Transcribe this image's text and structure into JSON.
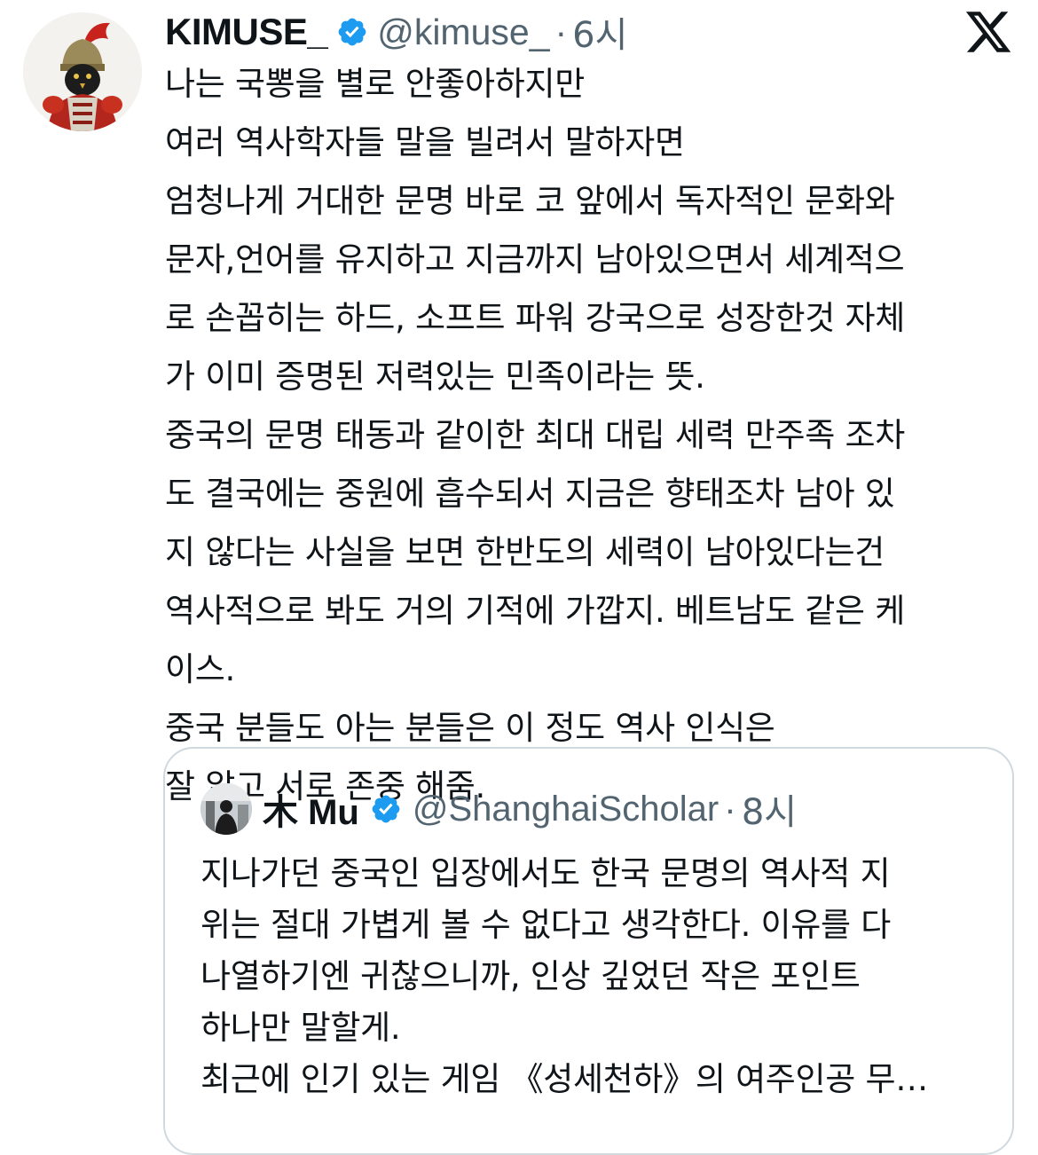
{
  "tweet": {
    "author": {
      "display_name": "KIMUSE_",
      "handle": "@kimuse_",
      "separator": "·",
      "time": "6시",
      "avatar_icon": "warrior-avatar-icon"
    },
    "verified_color": "#1d9bf0",
    "text_lines": [
      "나는 국뽕을 별로 안좋아하지만",
      "여러 역사학자들 말을 빌려서 말하자면",
      "엄청나게 거대한 문명 바로 코 앞에서 독자적인 문화와",
      "문자,언어를 유지하고 지금까지 남아있으면서 세계적으",
      "로 손꼽히는 하드, 소프트 파워 강국으로 성장한것 자체",
      "가 이미 증명된 저력있는 민족이라는 뜻.",
      "중국의 문명 태동과 같이한 최대 대립 세력 만주족 조차",
      "도 결국에는 중원에 흡수되서 지금은 향태조차 남아 있",
      "지 않다는 사실을 보면 한반도의 세력이 남아있다는건",
      "역사적으로 봐도 거의 기적에 가깝지. 베트남도 같은 케",
      "이스.",
      "중국 분들도 아는 분들은 이 정도 역사 인식은",
      "잘 알고 서로 존중 해줌."
    ]
  },
  "quoted_tweet": {
    "author": {
      "display_name": "木 Mu",
      "handle": "@ShanghaiScholar",
      "separator": "·",
      "time": "8시",
      "avatar_icon": "person-avatar-icon"
    },
    "text_lines": [
      "지나가던 중국인 입장에서도 한국 문명의 역사적 지",
      "위는 절대 가볍게 볼 수 없다고 생각한다. 이유를 다",
      "나열하기엔 귀찮으니까, 인상 깊었던 작은 포인트",
      "하나만 말할게.",
      "최근에 인기 있는 게임 《성세천하》의 여주인공 무…"
    ]
  },
  "platform_icon": "x-logo-icon"
}
